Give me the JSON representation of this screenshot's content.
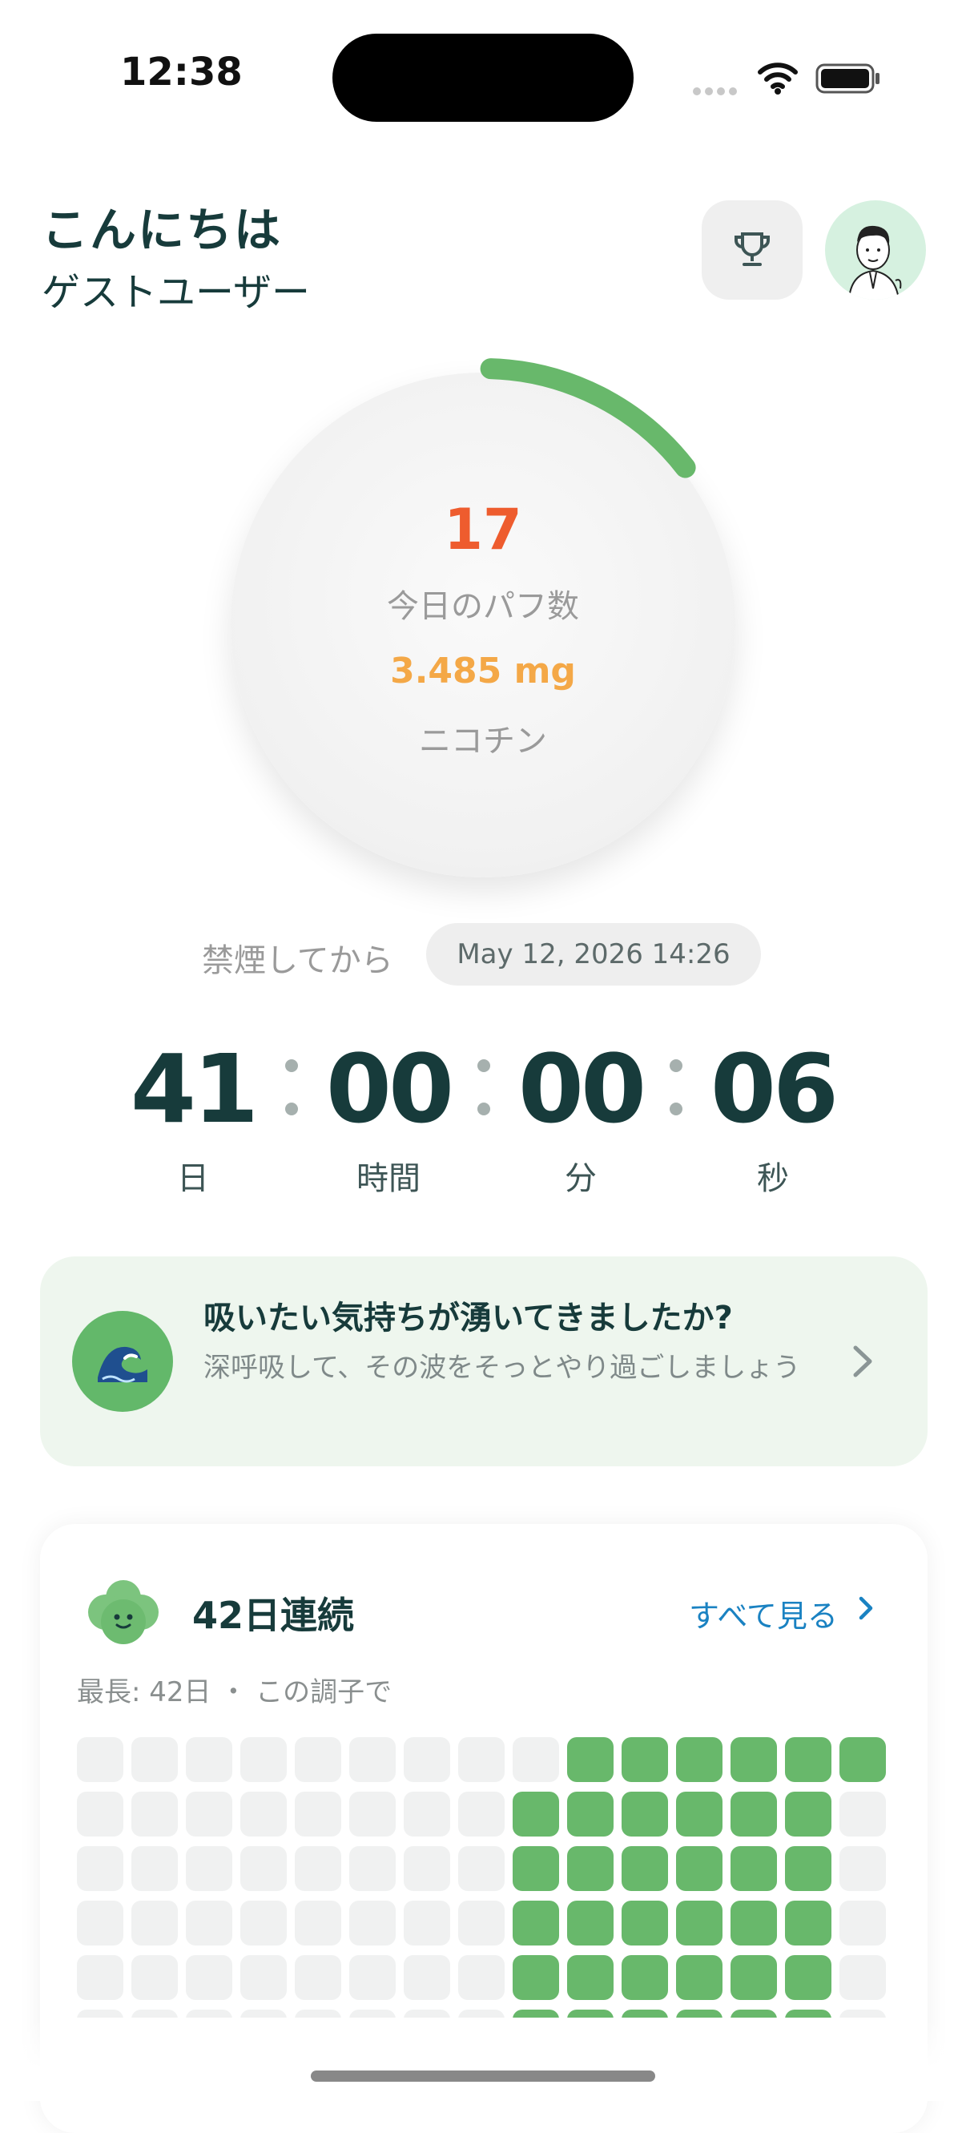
{
  "status_bar": {
    "time": "12:38"
  },
  "header": {
    "greeting": "こんにちは",
    "user_name": "ゲストユーザー"
  },
  "puff_counter": {
    "count": "17",
    "count_label": "今日のパフ数",
    "nicotine": "3.485 mg",
    "nicotine_label": "ニコチン",
    "progress_fraction": 0.14
  },
  "quit_since": {
    "label": "禁煙してから",
    "date": "May 12, 2026 14:26"
  },
  "timer": {
    "days": "41",
    "days_unit": "日",
    "hours": "00",
    "hours_unit": "時間",
    "minutes": "00",
    "minutes_unit": "分",
    "seconds": "06",
    "seconds_unit": "秒"
  },
  "craving_card": {
    "icon": "wave-emoji-icon",
    "title": "吸いたい気持ちが湧いてきましたか?",
    "subtitle": "深呼吸して、その波をそっとやり過ごしましょう"
  },
  "streak": {
    "title": "42日連続",
    "see_all": "すべて見る",
    "subtitle": "最長: 42日 ・ この調子で",
    "grid_columns": 15,
    "grid_rows": [
      [
        0,
        0,
        0,
        0,
        0,
        0,
        0,
        0,
        0,
        1,
        1,
        1,
        1,
        1,
        1
      ],
      [
        0,
        0,
        0,
        0,
        0,
        0,
        0,
        0,
        1,
        1,
        1,
        1,
        1,
        1,
        0
      ],
      [
        0,
        0,
        0,
        0,
        0,
        0,
        0,
        0,
        1,
        1,
        1,
        1,
        1,
        1,
        0
      ],
      [
        0,
        0,
        0,
        0,
        0,
        0,
        0,
        0,
        1,
        1,
        1,
        1,
        1,
        1,
        0
      ],
      [
        0,
        0,
        0,
        0,
        0,
        0,
        0,
        0,
        1,
        1,
        1,
        1,
        1,
        1,
        0
      ],
      [
        0,
        0,
        0,
        0,
        0,
        0,
        0,
        0,
        1,
        1,
        1,
        1,
        1,
        1,
        0
      ]
    ]
  },
  "colors": {
    "accent_green": "#68b86b",
    "puff_orange": "#ee5c2e",
    "nicotine_amber": "#f4a847",
    "link_blue": "#1a82c2",
    "text_dark": "#173b3b"
  }
}
